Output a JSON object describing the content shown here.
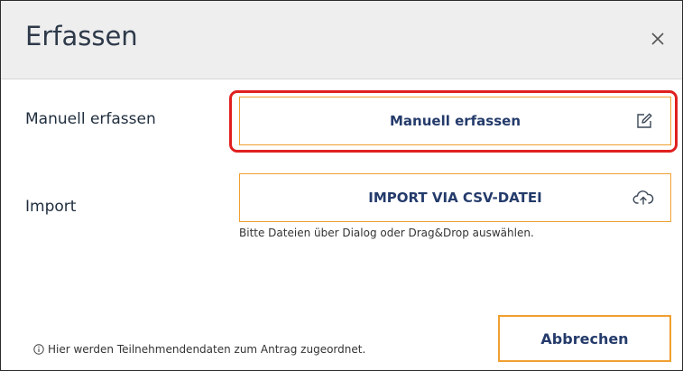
{
  "dialog": {
    "title": "Erfassen",
    "close_icon": "close-icon"
  },
  "manual": {
    "label": "Manuell erfassen",
    "button_label": "Manuell erfassen",
    "icon": "edit-icon"
  },
  "import": {
    "label": "Import",
    "button_label": "IMPORT VIA CSV-DATEI",
    "icon": "cloud-upload-icon",
    "hint": "Bitte Dateien über Dialog oder Drag&Drop auswählen."
  },
  "footer": {
    "info_icon": "info-icon",
    "note": "Hier werden Teilnehmendendaten zum Antrag zugeordnet.",
    "cancel_label": "Abbrechen"
  },
  "colors": {
    "accent_border": "#f0a030",
    "highlight": "#e02020",
    "button_text": "#243b6b",
    "header_bg": "#eeeeee"
  }
}
